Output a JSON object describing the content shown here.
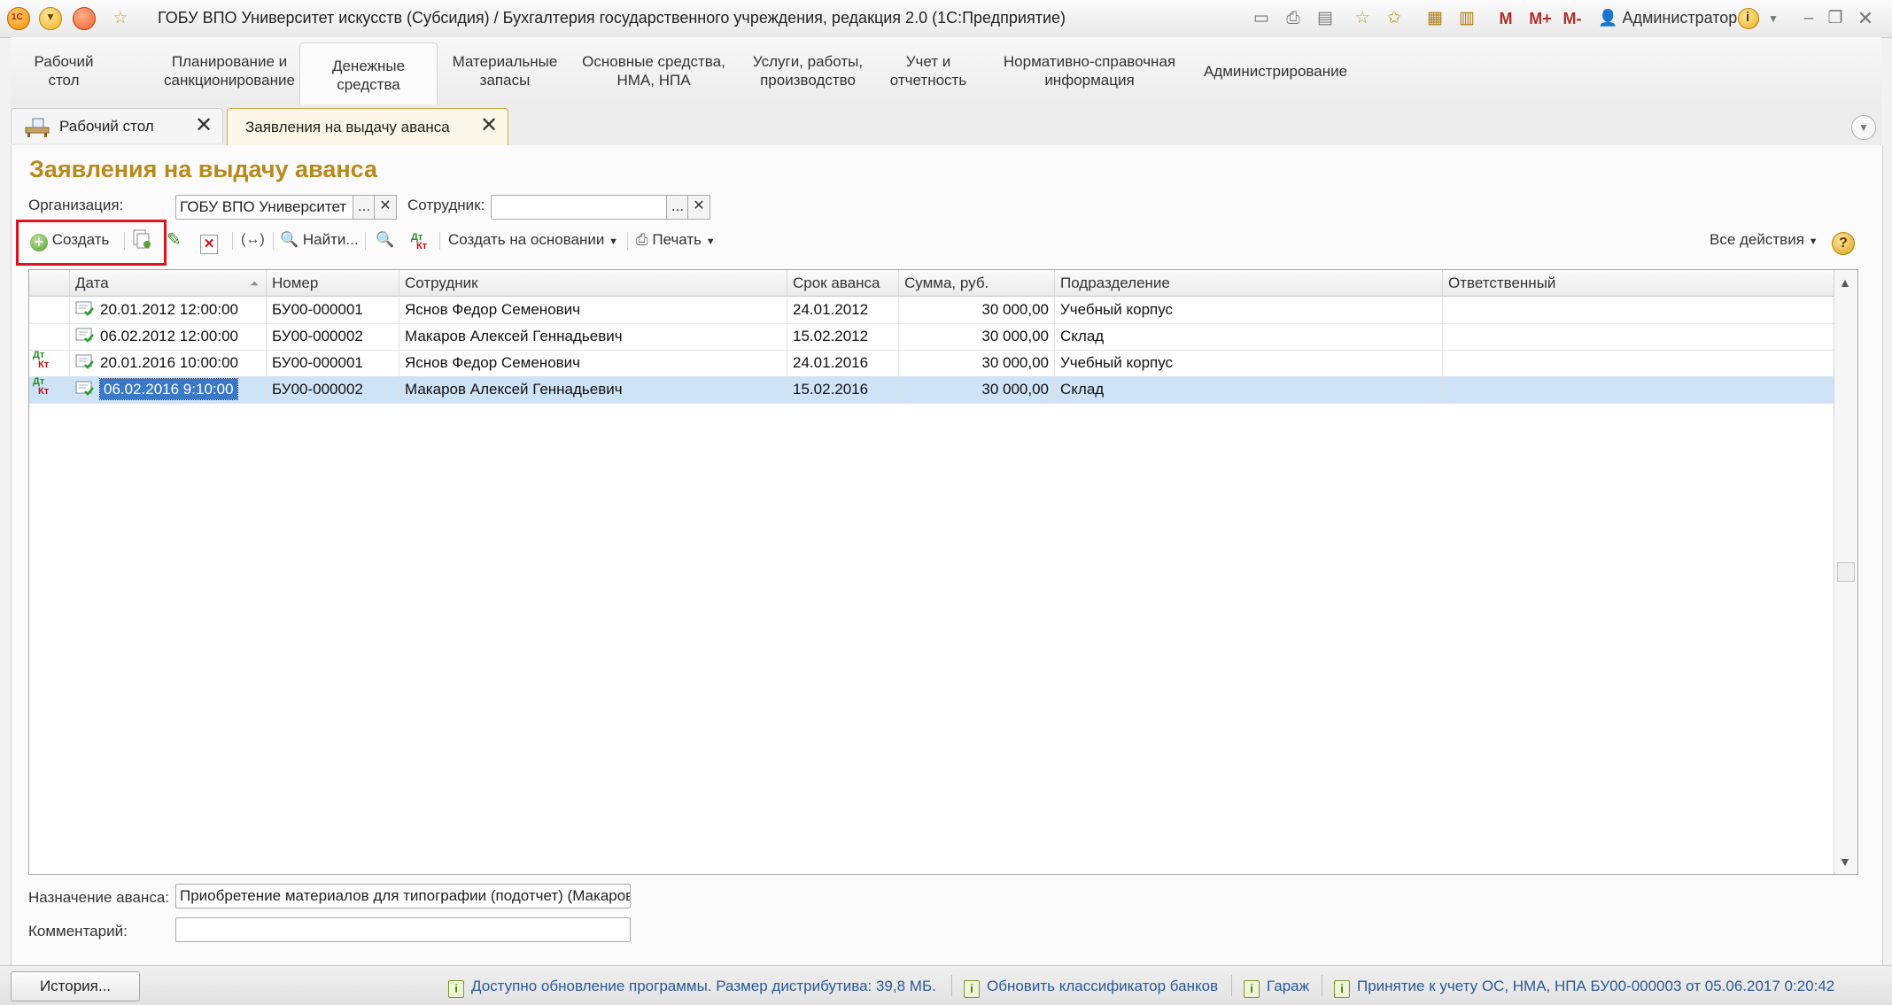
{
  "window": {
    "title": "ГОБУ ВПО Университет искусств (Субсидия) / Бухгалтерия государственного учреждения, редакция 2.0  (1С:Предприятие)",
    "memory_buttons": [
      "M",
      "M+",
      "M-"
    ],
    "user": "Администратор"
  },
  "sections": [
    {
      "label": "Рабочий\nстол"
    },
    {
      "label": "Планирование и\nсанкционирование"
    },
    {
      "label": "Денежные\nсредства",
      "active": true
    },
    {
      "label": "Материальные\nзапасы"
    },
    {
      "label": "Основные средства,\nНМА, НПА"
    },
    {
      "label": "Услуги, работы,\nпроизводство"
    },
    {
      "label": "Учет и\nотчетность"
    },
    {
      "label": "Нормативно-справочная\nинформация"
    },
    {
      "label": "Администрирование"
    }
  ],
  "tabs": [
    {
      "label": "Рабочий стол"
    },
    {
      "label": "Заявления на выдачу аванса",
      "active": true
    }
  ],
  "form": {
    "title": "Заявления на выдачу аванса",
    "organization_label": "Организация:",
    "organization_value": "ГОБУ ВПО Университет",
    "employee_label": "Сотрудник:",
    "employee_value": "",
    "ellipsis": "...",
    "clear": "✕"
  },
  "toolbar": {
    "create": "Создать",
    "find": "Найти...",
    "create_based": "Создать на основании",
    "print": "Печать",
    "all_actions": "Все действия",
    "help": "?"
  },
  "table": {
    "columns": [
      "Дата",
      "Номер",
      "Сотрудник",
      "Срок аванса",
      "Сумма, руб.",
      "Подразделение",
      "Ответственный"
    ],
    "rows": [
      {
        "dtkt": false,
        "date": "20.01.2012 12:00:00",
        "number": "БУ00-000001",
        "employee": "Яснов Федор Семенович",
        "due": "24.01.2012",
        "amount": "30 000,00",
        "dept": "Учебный корпус",
        "responsible": ""
      },
      {
        "dtkt": false,
        "date": "06.02.2012 12:00:00",
        "number": "БУ00-000002",
        "employee": "Макаров Алексей Геннадьевич",
        "due": "15.02.2012",
        "amount": "30 000,00",
        "dept": "Склад",
        "responsible": ""
      },
      {
        "dtkt": true,
        "date": "20.01.2016 10:00:00",
        "number": "БУ00-000001",
        "employee": "Яснов Федор Семенович",
        "due": "24.01.2016",
        "amount": "30 000,00",
        "dept": "Учебный корпус",
        "responsible": ""
      },
      {
        "dtkt": true,
        "date": "06.02.2016 9:10:00",
        "number": "БУ00-000002",
        "employee": "Макаров Алексей Геннадьевич",
        "due": "15.02.2016",
        "amount": "30 000,00",
        "dept": "Склад",
        "responsible": "",
        "selected": true
      }
    ],
    "dt_label": "Дт",
    "kt_label": "Кт"
  },
  "footer": {
    "purpose_label": "Назначение аванса:",
    "purpose_value": "Приобретение материалов для типографии (подотчет) (Макаров",
    "comment_label": "Комментарий:",
    "comment_value": ""
  },
  "statusbar": {
    "history": "История...",
    "messages": [
      "Доступно обновление программы. Размер дистрибутива: 39,8 МБ.",
      "Обновить классификатор банков",
      "Гараж",
      "Принятие к учету ОС, НМА, НПА БУ00-000003 от 05.06.2017 0:20:42"
    ]
  },
  "colors": {
    "accent": "#b88a1c",
    "selection": "#cfe3f7",
    "highlight_box": "#e0141e"
  }
}
